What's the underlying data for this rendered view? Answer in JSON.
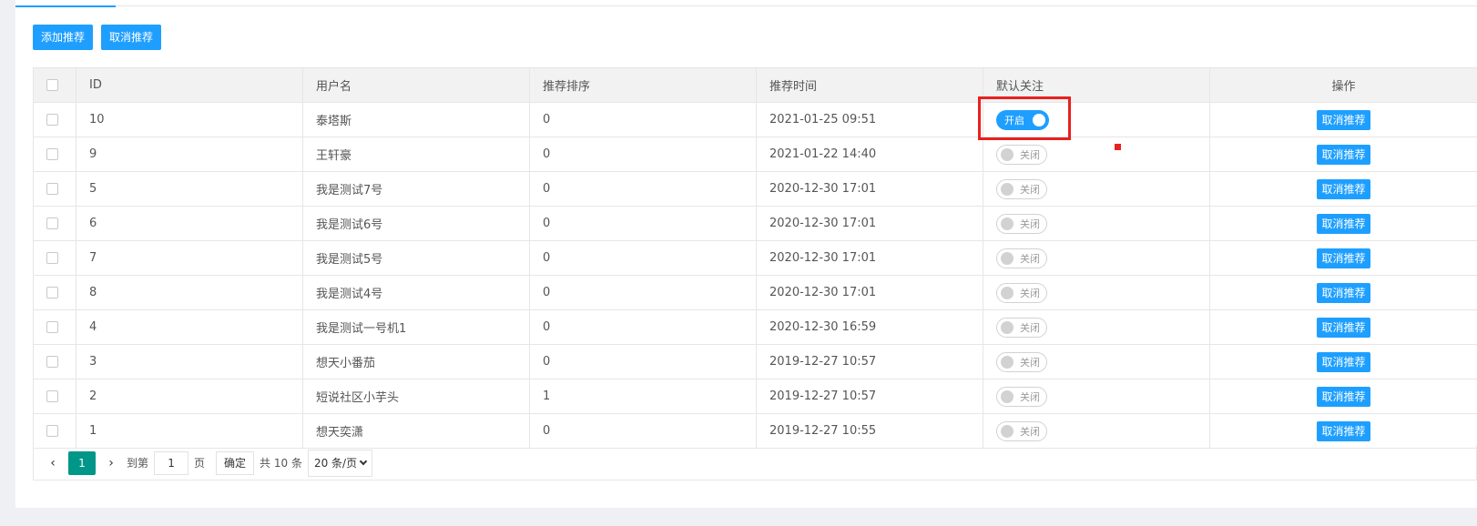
{
  "toolbar": {
    "add_label": "添加推荐",
    "cancel_label": "取消推荐"
  },
  "table": {
    "headers": {
      "id": "ID",
      "username": "用户名",
      "sort": "推荐排序",
      "time": "推荐时间",
      "follow": "默认关注",
      "action": "操作"
    },
    "rows": [
      {
        "id": "10",
        "username": "泰塔斯",
        "sort": "0",
        "time": "2021-01-25 09:51",
        "follow": "开启",
        "follow_on": true,
        "action": "取消推荐"
      },
      {
        "id": "9",
        "username": "王轩豪",
        "sort": "0",
        "time": "2021-01-22 14:40",
        "follow": "关闭",
        "follow_on": false,
        "action": "取消推荐"
      },
      {
        "id": "5",
        "username": "我是测试7号",
        "sort": "0",
        "time": "2020-12-30 17:01",
        "follow": "关闭",
        "follow_on": false,
        "action": "取消推荐"
      },
      {
        "id": "6",
        "username": "我是测试6号",
        "sort": "0",
        "time": "2020-12-30 17:01",
        "follow": "关闭",
        "follow_on": false,
        "action": "取消推荐"
      },
      {
        "id": "7",
        "username": "我是测试5号",
        "sort": "0",
        "time": "2020-12-30 17:01",
        "follow": "关闭",
        "follow_on": false,
        "action": "取消推荐"
      },
      {
        "id": "8",
        "username": "我是测试4号",
        "sort": "0",
        "time": "2020-12-30 17:01",
        "follow": "关闭",
        "follow_on": false,
        "action": "取消推荐"
      },
      {
        "id": "4",
        "username": "我是测试一号机1",
        "sort": "0",
        "time": "2020-12-30 16:59",
        "follow": "关闭",
        "follow_on": false,
        "action": "取消推荐"
      },
      {
        "id": "3",
        "username": "想天小番茄",
        "sort": "0",
        "time": "2019-12-27 10:57",
        "follow": "关闭",
        "follow_on": false,
        "action": "取消推荐"
      },
      {
        "id": "2",
        "username": "短说社区小芋头",
        "sort": "1",
        "time": "2019-12-27 10:57",
        "follow": "关闭",
        "follow_on": false,
        "action": "取消推荐"
      },
      {
        "id": "1",
        "username": "想天奕潇",
        "sort": "0",
        "time": "2019-12-27 10:55",
        "follow": "关闭",
        "follow_on": false,
        "action": "取消推荐"
      }
    ]
  },
  "pagination": {
    "prev_icon": "chevron-left-icon",
    "current_page": "1",
    "next_icon": "chevron-right-icon",
    "goto_label": "到第",
    "goto_value": "1",
    "page_label": "页",
    "confirm_label": "确定",
    "total_label": "共 10 条",
    "page_size": "20 条/页"
  },
  "colors": {
    "primary": "#1e9fff",
    "pager_active": "#009688",
    "highlight": "#e8211f"
  }
}
